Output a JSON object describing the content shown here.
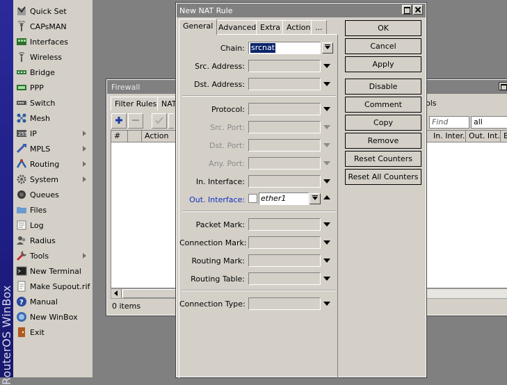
{
  "brand": {
    "text": "RouterOS WinBox"
  },
  "menu": {
    "items": [
      {
        "label": "Quick Set",
        "icon": "quick-set-icon",
        "submenu": false
      },
      {
        "label": "CAPsMAN",
        "icon": "capsman-icon",
        "submenu": false
      },
      {
        "label": "Interfaces",
        "icon": "interfaces-icon",
        "submenu": false
      },
      {
        "label": "Wireless",
        "icon": "wireless-icon",
        "submenu": false
      },
      {
        "label": "Bridge",
        "icon": "bridge-icon",
        "submenu": false
      },
      {
        "label": "PPP",
        "icon": "ppp-icon",
        "submenu": false
      },
      {
        "label": "Switch",
        "icon": "switch-icon",
        "submenu": false
      },
      {
        "label": "Mesh",
        "icon": "mesh-icon",
        "submenu": false
      },
      {
        "label": "IP",
        "icon": "ip-icon",
        "submenu": true
      },
      {
        "label": "MPLS",
        "icon": "mpls-icon",
        "submenu": true
      },
      {
        "label": "Routing",
        "icon": "routing-icon",
        "submenu": true
      },
      {
        "label": "System",
        "icon": "system-icon",
        "submenu": true
      },
      {
        "label": "Queues",
        "icon": "queues-icon",
        "submenu": false
      },
      {
        "label": "Files",
        "icon": "files-icon",
        "submenu": false
      },
      {
        "label": "Log",
        "icon": "log-icon",
        "submenu": false
      },
      {
        "label": "Radius",
        "icon": "radius-icon",
        "submenu": false
      },
      {
        "label": "Tools",
        "icon": "tools-icon",
        "submenu": true
      },
      {
        "label": "New Terminal",
        "icon": "terminal-icon",
        "submenu": false
      },
      {
        "label": "Make Supout.rif",
        "icon": "supout-icon",
        "submenu": false
      },
      {
        "label": "Manual",
        "icon": "manual-icon",
        "submenu": false
      },
      {
        "label": "New WinBox",
        "icon": "winbox-icon",
        "submenu": false
      },
      {
        "label": "Exit",
        "icon": "exit-icon",
        "submenu": false
      }
    ]
  },
  "firewall": {
    "title": "Firewall",
    "tabs": [
      "Filter Rules",
      "NAT"
    ],
    "right_partial_label": "ols",
    "columns": [
      "#",
      "Action",
      "In. Inter...",
      "Out. Int...",
      "B"
    ],
    "find_placeholder": "Find",
    "filter_value": "all",
    "status": "0 items"
  },
  "nat": {
    "title": "New NAT Rule",
    "tabs": [
      "General",
      "Advanced",
      "Extra",
      "Action",
      "..."
    ],
    "active_tab": "General",
    "fields": {
      "chain": {
        "label": "Chain:",
        "value": "srcnat"
      },
      "src_address": {
        "label": "Src. Address:"
      },
      "dst_address": {
        "label": "Dst. Address:"
      },
      "protocol": {
        "label": "Protocol:"
      },
      "src_port": {
        "label": "Src. Port:"
      },
      "dst_port": {
        "label": "Dst. Port:"
      },
      "any_port": {
        "label": "Any. Port:"
      },
      "in_interface": {
        "label": "In. Interface:"
      },
      "out_interface": {
        "label": "Out. Interface:",
        "value": "ether1",
        "negate": false
      },
      "packet_mark": {
        "label": "Packet Mark:"
      },
      "connection_mark": {
        "label": "Connection Mark:"
      },
      "routing_mark": {
        "label": "Routing Mark:"
      },
      "routing_table": {
        "label": "Routing Table:"
      },
      "connection_type": {
        "label": "Connection Type:"
      }
    },
    "buttons": [
      "OK",
      "Cancel",
      "Apply",
      "Disable",
      "Comment",
      "Copy",
      "Remove",
      "Reset Counters",
      "Reset All Counters"
    ]
  },
  "colors": {
    "brand_strip": "#1e1e86",
    "panel": "#d4d0c8",
    "desktop": "#808080",
    "selection": "#0a246a",
    "blue_label": "#1030c0"
  }
}
